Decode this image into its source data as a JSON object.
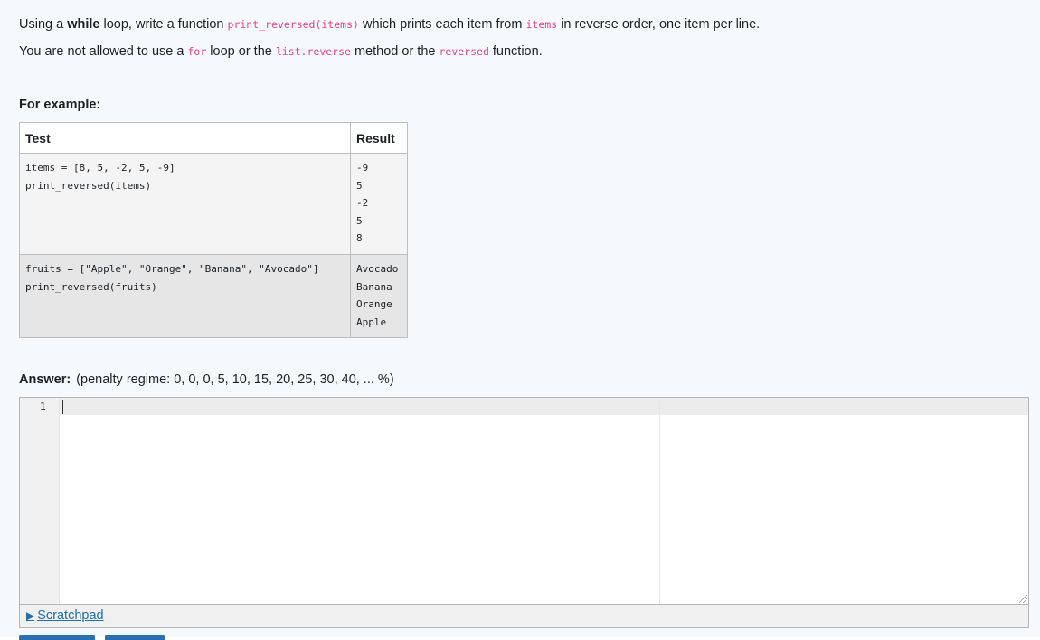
{
  "question": {
    "line1": {
      "t1": "Using a ",
      "t2": "while",
      "t3": " loop, write a function ",
      "c1": "print_reversed(items)",
      "t4": " which prints each item from ",
      "c2": "items",
      "t5": " in reverse order, one item per line."
    },
    "line2": {
      "t1": "You are not allowed to use a ",
      "c1": "for",
      "t2": " loop or the ",
      "c2": "list.reverse",
      "t3": " method or the ",
      "c3": "reversed",
      "t4": " function."
    }
  },
  "examples": {
    "heading": "For example:",
    "headers": {
      "test": "Test",
      "result": "Result"
    },
    "rows": [
      {
        "test": [
          "items = [8, 5, -2, 5, -9]",
          "print_reversed(items)"
        ],
        "result": [
          "-9",
          "5",
          "-2",
          "5",
          "8"
        ]
      },
      {
        "test": [
          "fruits = [\"Apple\", \"Orange\", \"Banana\", \"Avocado\"]",
          "print_reversed(fruits)"
        ],
        "result": [
          "Avocado",
          "Banana",
          "Orange",
          "Apple"
        ]
      }
    ]
  },
  "answer": {
    "label": "Answer:",
    "penalty": "(penalty regime: 0, 0, 0, 5, 10, 15, 20, 25, 30, 40, ... %)",
    "line_numbers": [
      "1"
    ],
    "code": ""
  },
  "scratchpad": {
    "arrow": "▶",
    "label": "Scratchpad"
  },
  "colors": {
    "code_text": "#e83e8c",
    "link": "#1f6fa8",
    "panel_bg": "#f5f9fc"
  }
}
